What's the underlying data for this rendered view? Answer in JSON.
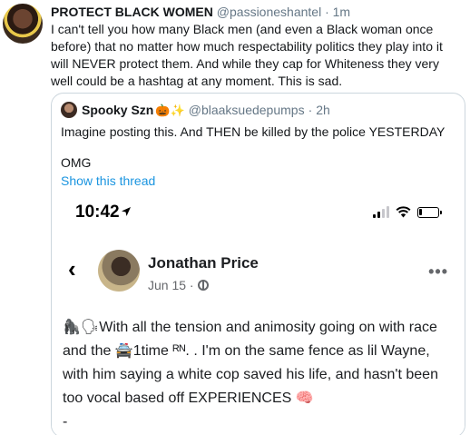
{
  "tweet": {
    "author_name": "PROTECT BLACK WOMEN",
    "author_handle": "@passioneshantel",
    "separator": "·",
    "time": "1m",
    "text": "I can't tell you how many Black men (and even a Black woman once before) that no matter how much respectability politics they play into it will NEVER protect them. And while they cap for Whiteness they very well could be a hashtag at any moment. This is sad."
  },
  "quote": {
    "author_name": "Spooky Szn",
    "name_emoji": "🎃✨",
    "author_handle": "@blaaksuedepumps",
    "separator": "·",
    "time": "2h",
    "text_line1": "Imagine posting this. And THEN be killed by the police YESTERDAY",
    "text_line2": "OMG",
    "show_thread": "Show this thread"
  },
  "screenshot": {
    "status_time": "10:42",
    "post_author": "Jonathan Price",
    "post_date": "Jun 15 ·",
    "more": "•••",
    "back": "‹",
    "post_text": "🦍🗣With all the tension and animosity going on with race and the 🚔1time ᴿᴺ. . I'm on the same fence as lil Wayne, with him saying a white cop saved his life, and hasn't been too vocal based off EXPERIENCES 🧠",
    "post_tail": "-"
  },
  "colors": {
    "link": "#1b95e0",
    "secondary_text": "#657786",
    "border": "#ccd6dd"
  },
  "icons": [
    "location-arrow-icon",
    "signal-bars-icon",
    "wifi-icon",
    "battery-icon",
    "back-chevron-icon",
    "globe-icon",
    "more-options-icon"
  ]
}
